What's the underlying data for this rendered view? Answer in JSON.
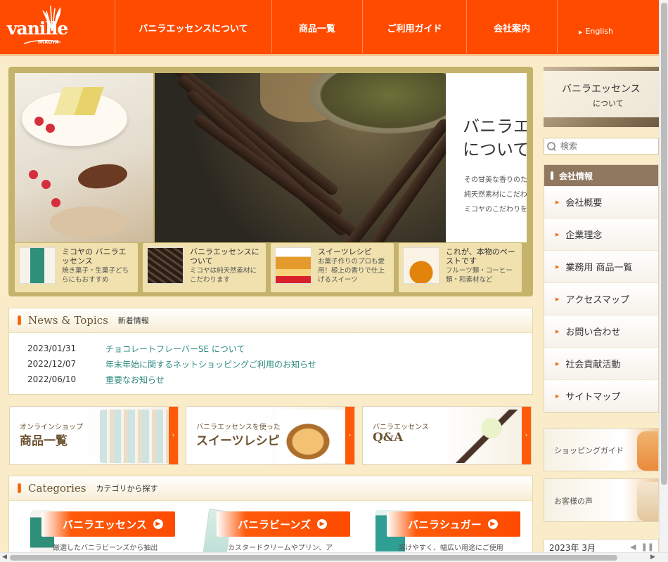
{
  "header": {
    "logo": "vanille",
    "logo_sub": "MIKOYA",
    "nav": [
      {
        "label": "バニラエッセンスについて",
        "width": 223
      },
      {
        "label": "商品一覧",
        "width": 129
      },
      {
        "label": "ご利用ガイド",
        "width": 148
      },
      {
        "label": "会社案内",
        "width": 129
      }
    ],
    "english": "English"
  },
  "hero": {
    "title_line1": "バニラエッセンス",
    "title_line2": "について",
    "desc_line1": "その甘美な香りのために",
    "desc_line2": "純天然素材にこだわり",
    "desc_line3": "ミコヤのこだわりをご紹介",
    "tabs": [
      {
        "title": "ミコヤの バニラエッセンス",
        "desc": "焼き菓子・生菓子どちらにもおすすめ"
      },
      {
        "title": "バニラエッセンスについて",
        "desc": "ミコヤは純天然素材にこだわります"
      },
      {
        "title": "スイーツレシピ",
        "desc": "お菓子作りのプロも愛用！極上の香りで仕上げるスイーツ"
      },
      {
        "title": "これが、本物のペーストです",
        "desc": "フルーツ類・コーヒー類・和素材など"
      }
    ]
  },
  "news": {
    "title_en": "News & Topics",
    "title_jp": "新着情報",
    "items": [
      {
        "date": "2023/01/31",
        "text": "チョコレートフレーバーSE について"
      },
      {
        "date": "2022/12/07",
        "text": "年末年始に関するネットショッピングご利用のお知らせ"
      },
      {
        "date": "2022/06/10",
        "text": "重要なお知らせ"
      }
    ]
  },
  "banners": [
    {
      "small": "オンラインショップ",
      "big": "商品一覧"
    },
    {
      "small": "バニラエッセンスを使った",
      "big": "スイーツレシピ"
    },
    {
      "small": "バニラエッセンス",
      "big": "Q&A"
    }
  ],
  "categories": {
    "title_en": "Categories",
    "title_jp": "カテゴリから探す",
    "items": [
      {
        "label": "バニラエッセンス",
        "desc": "厳選したバニラビーンズから抽出"
      },
      {
        "label": "バニラビーンズ",
        "desc": "カスタードクリームやプリン、ア"
      },
      {
        "label": "バニラシュガー",
        "desc": "溶けやすく、幅広い用途にご使用"
      }
    ]
  },
  "sidebar": {
    "head_line1": "バニラエッセンス",
    "head_line2": "について",
    "search_placeholder": "検索",
    "company_title": "会社情報",
    "company_items": [
      "会社概要",
      "企業理念",
      "業務用 商品一覧",
      "アクセスマップ",
      "お問い合わせ",
      "社会貢献活動",
      "サイトマップ"
    ],
    "shopping_guide": "ショッピングガイド",
    "customer_voice": "お客様の声",
    "calendar_month": "2023年 3月"
  },
  "colors": {
    "brand": "#fe4b00",
    "accent": "#f26a13",
    "link": "#2f8b82",
    "background": "#fbecc9"
  }
}
